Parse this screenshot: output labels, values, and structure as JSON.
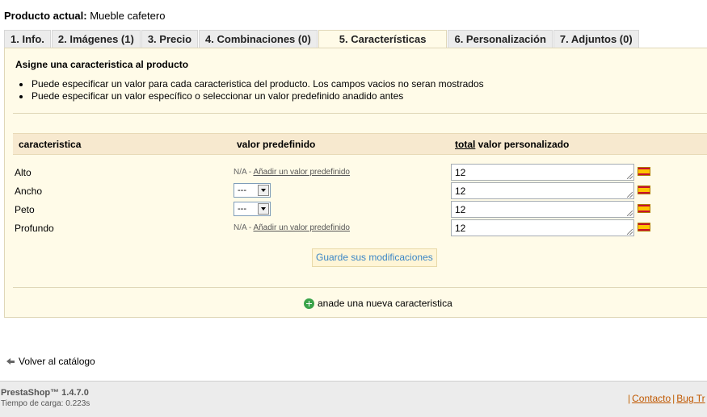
{
  "header": {
    "label": "Producto actual:",
    "product": "Mueble cafetero"
  },
  "tabs": [
    {
      "label": "1. Info."
    },
    {
      "label": "2. Imágenes (1)"
    },
    {
      "label": "3. Precio"
    },
    {
      "label": "4. Combinaciones (0)"
    },
    {
      "label": "5. Características"
    },
    {
      "label": "6. Personalización"
    },
    {
      "label": "7. Adjuntos (0)"
    }
  ],
  "active_tab": "5. Características",
  "instructions": {
    "title": "Asigne una caracteristica al producto",
    "items": [
      "Puede especificar un valor para cada caracteristica del producto. Los campos vacios no seran mostrados",
      "Puede especificar un valor específico o seleccionar un valor predefinido anadido antes"
    ]
  },
  "table": {
    "col_feature": "caracteristica",
    "col_predefined": "valor predefinido",
    "col_custom_strong": "total",
    "col_custom_rest": " valor personalizado"
  },
  "rows": [
    {
      "label": "Alto",
      "na": "N/A - ",
      "link": "Añadir un valor predefinido",
      "value": "12"
    },
    {
      "label": "Ancho",
      "select": "---",
      "value": "12"
    },
    {
      "label": "Peto",
      "select": "---",
      "value": "12"
    },
    {
      "label": "Profundo",
      "na": "N/A - ",
      "link": "Añadir un valor predefinido",
      "value": "12"
    }
  ],
  "save_button": "Guarde sus modificaciones",
  "add_feature": "anade una nueva caracteristica",
  "back_link": "Volver al catálogo",
  "footer": {
    "brand": "PrestaShop™ 1.4.7.0",
    "load_time": "Tiempo de carga: 0.223s",
    "contact": "Contacto",
    "bug": "Bug Tr"
  },
  "icons": {
    "flag": "spain-flag-icon",
    "add": "plus-circle-icon",
    "back": "arrow-left-icon"
  }
}
